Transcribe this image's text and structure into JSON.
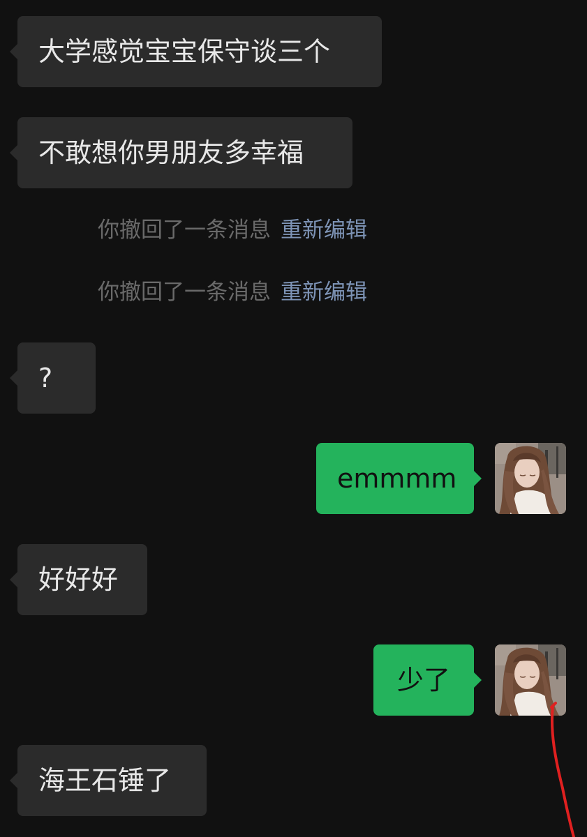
{
  "colors": {
    "background": "#111111",
    "incoming_bubble": "#2b2b2b",
    "outgoing_bubble": "#24b35c",
    "system_text": "#6a6a6a",
    "link_text": "#7d93b5",
    "annotation_line": "#e02020"
  },
  "messages": [
    {
      "side": "in",
      "text": "大学感觉宝宝保守谈三个"
    },
    {
      "side": "in",
      "text": "不敢想你男朋友多幸福"
    },
    {
      "side": "system",
      "text": "你撤回了一条消息",
      "link": "重新编辑"
    },
    {
      "side": "system",
      "text": "你撤回了一条消息",
      "link": "重新编辑"
    },
    {
      "side": "in",
      "text": "?"
    },
    {
      "side": "out",
      "text": "emmmm",
      "avatar": "user-avatar-photo"
    },
    {
      "side": "in",
      "text": "好好好"
    },
    {
      "side": "out",
      "text": "少了",
      "avatar": "user-avatar-photo"
    },
    {
      "side": "in",
      "text": "海王石锤了"
    }
  ]
}
